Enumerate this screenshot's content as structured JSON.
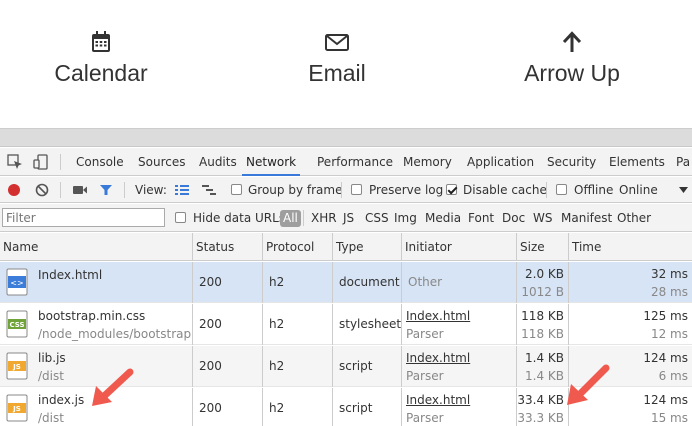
{
  "demo": {
    "items": [
      {
        "label": "Calendar",
        "icon": "calendar-icon"
      },
      {
        "label": "Email",
        "icon": "envelope-icon"
      },
      {
        "label": "Arrow Up",
        "icon": "arrow-up-icon"
      }
    ]
  },
  "devtools": {
    "tabs": [
      "Console",
      "Sources",
      "Audits",
      "Network",
      "Performance",
      "Memory",
      "Application",
      "Security",
      "Elements",
      "Pa"
    ],
    "active_tab": "Network",
    "toolbar": {
      "view_label": "View:",
      "group_by_frame": "Group by frame",
      "preserve_log": "Preserve log",
      "disable_cache": "Disable cache",
      "offline": "Offline",
      "online": "Online"
    },
    "filterbar": {
      "placeholder": "Filter",
      "hide_data_urls": "Hide data URLs",
      "types": [
        "All",
        "XHR",
        "JS",
        "CSS",
        "Img",
        "Media",
        "Font",
        "Doc",
        "WS",
        "Manifest",
        "Other"
      ]
    },
    "columns": [
      "Name",
      "Status",
      "Protocol",
      "Type",
      "Initiator",
      "Size",
      "Time"
    ],
    "rows": [
      {
        "name": "Index.html",
        "path": "",
        "status": "200",
        "protocol": "h2",
        "type": "document",
        "initiator": "Other",
        "initiator_sub": "",
        "size": "2.0 KB",
        "size_sub": "1012 B",
        "time": "32 ms",
        "time_sub": "28 ms",
        "icon": "html-file-icon"
      },
      {
        "name": "bootstrap.min.css",
        "path": "/node_modules/bootstrap...",
        "status": "200",
        "protocol": "h2",
        "type": "stylesheet",
        "initiator": "Index.html",
        "initiator_sub": "Parser",
        "size": "118 KB",
        "size_sub": "118 KB",
        "time": "125 ms",
        "time_sub": "12 ms",
        "icon": "css-file-icon"
      },
      {
        "name": "lib.js",
        "path": "/dist",
        "status": "200",
        "protocol": "h2",
        "type": "script",
        "initiator": "Index.html",
        "initiator_sub": "Parser",
        "size": "1.4 KB",
        "size_sub": "1.4 KB",
        "time": "124 ms",
        "time_sub": "6 ms",
        "icon": "js-file-icon"
      },
      {
        "name": "index.js",
        "path": "/dist",
        "status": "200",
        "protocol": "h2",
        "type": "script",
        "initiator": "Index.html",
        "initiator_sub": "Parser",
        "size": "33.4 KB",
        "size_sub": "33.3 KB",
        "time": "124 ms",
        "time_sub": "15 ms",
        "icon": "js-file-icon"
      }
    ],
    "colors": {
      "accent": "#3879d9",
      "record": "#d32f2f",
      "annotation": "#f05a4e"
    }
  }
}
